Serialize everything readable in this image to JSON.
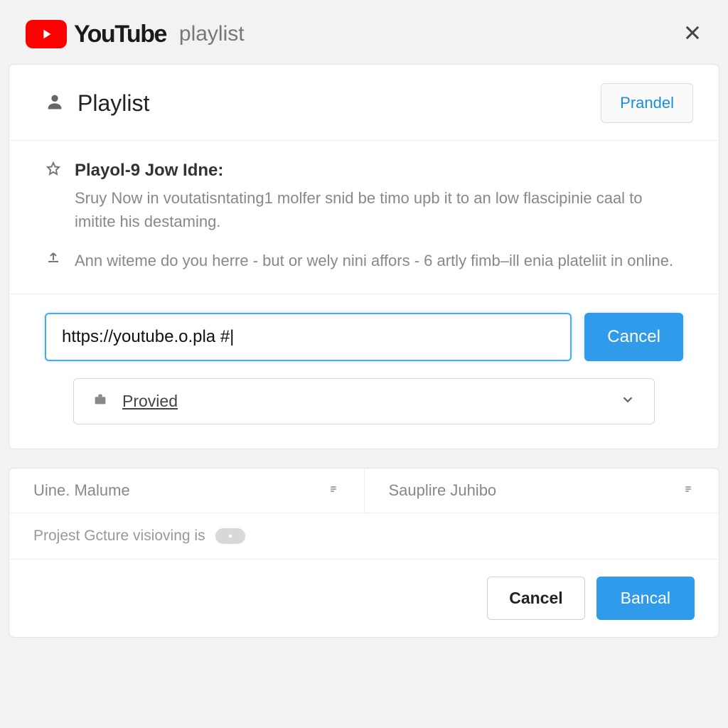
{
  "header": {
    "brand": "YouTube",
    "subtitle": "playlist"
  },
  "main_card": {
    "title": "Playlist",
    "header_button": "Prandel",
    "info1_title": "Playol-9 Jow Idne:",
    "info1_desc": "Sruy Now in voutatisntating1 molfer snid be timo upb it to an low flascipinie caal to imitite his destaming.",
    "info2_text": "Ann witeme do you herre - but or wely nini affors - 6 artly fimb–ill enia plateliit in online.",
    "url_value": "https://youtube.o.pla #|",
    "url_button": "Cancel",
    "select_label": "Provied"
  },
  "lower_card": {
    "col1": "Uine. Malume",
    "col2": "Sauplire Juhibo",
    "status_text": "Projest Gcture visioving is"
  },
  "footer": {
    "cancel": "Cancel",
    "confirm": "Bancal"
  }
}
